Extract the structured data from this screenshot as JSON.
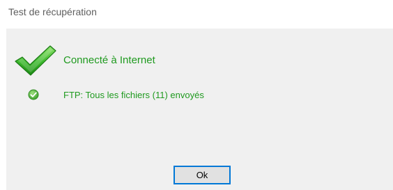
{
  "window": {
    "title": "Test de récupération"
  },
  "status": {
    "connection_label": "Connecté à Internet",
    "ftp_label": "FTP: Tous les fichiers (11) envoyés",
    "main_icon": "big-green-checkmark-icon",
    "sub_icon": "small-green-check-circle-icon",
    "success_color": "#1f9a1f"
  },
  "buttons": {
    "ok_label": "Ok",
    "ok_focus_color": "#0078d7"
  }
}
